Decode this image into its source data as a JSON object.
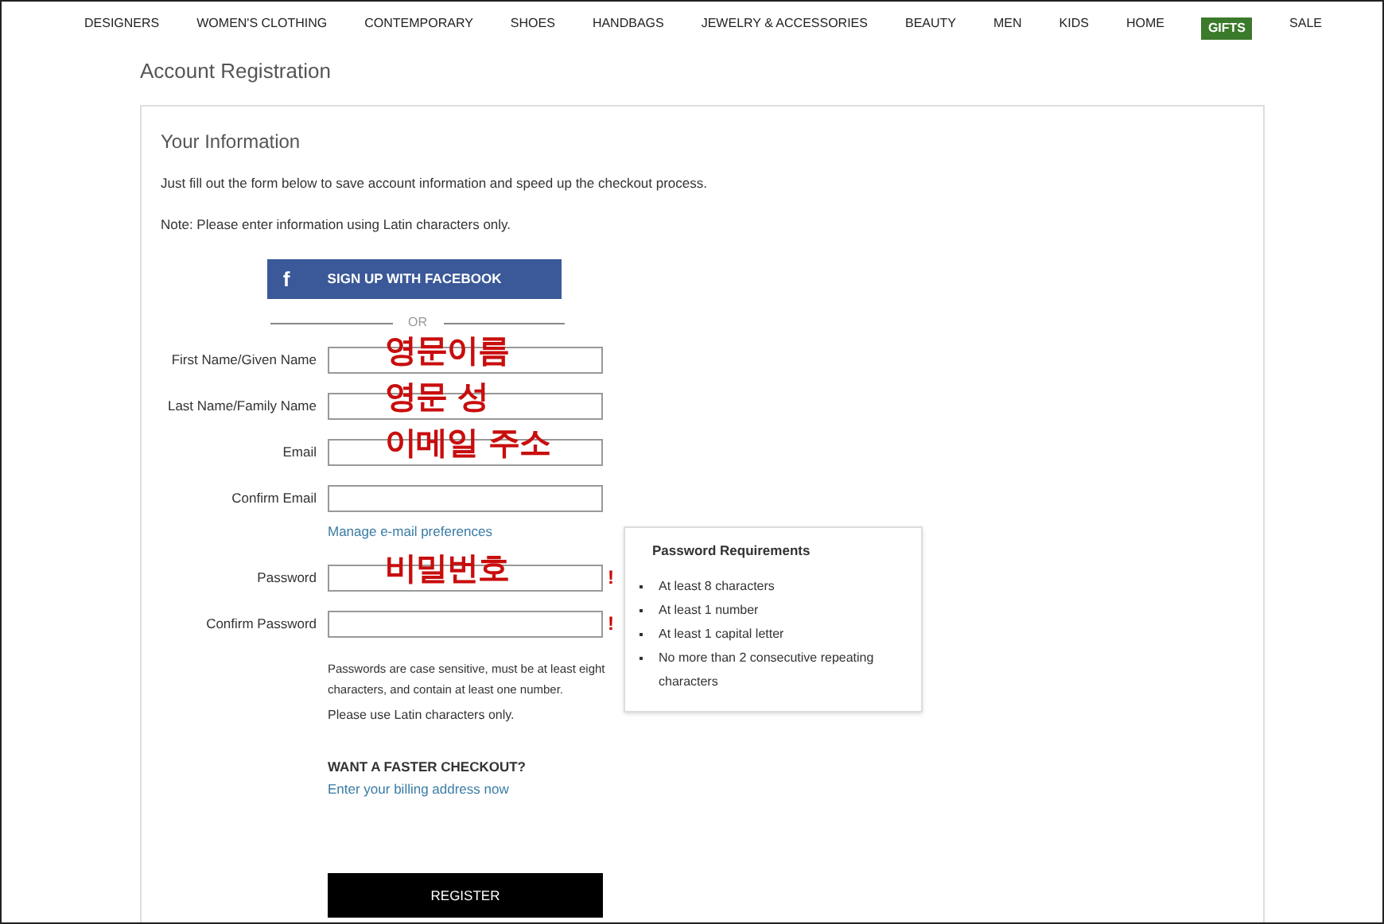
{
  "nav": [
    {
      "label": "DESIGNERS",
      "kind": "text"
    },
    {
      "label": "WOMEN'S CLOTHING",
      "kind": "text"
    },
    {
      "label": "CONTEMPORARY",
      "kind": "text"
    },
    {
      "label": "SHOES",
      "kind": "text"
    },
    {
      "label": "HANDBAGS",
      "kind": "text"
    },
    {
      "label": "JEWELRY & ACCESSORIES",
      "kind": "text"
    },
    {
      "label": "BEAUTY",
      "kind": "text"
    },
    {
      "label": "MEN",
      "kind": "text"
    },
    {
      "label": "KIDS",
      "kind": "text"
    },
    {
      "label": "HOME",
      "kind": "text"
    },
    {
      "label": "GIFTS",
      "kind": "badge"
    },
    {
      "label": "SALE",
      "kind": "text"
    }
  ],
  "page_title": "Account Registration",
  "section_title": "Your Information",
  "intro": "Just fill out the form below to save account information and speed up the checkout process.",
  "note": "Note: Please enter information using Latin characters only.",
  "facebook_button": {
    "icon": "f",
    "label": "SIGN UP WITH FACEBOOK"
  },
  "divider_text": "OR",
  "fields": [
    {
      "label": "First Name/Given Name",
      "annotation": "영문이름",
      "error": false
    },
    {
      "label": "Last Name/Family Name",
      "annotation": "영문 성",
      "error": false
    },
    {
      "label": "Email",
      "annotation": "이메일 주소",
      "error": false
    },
    {
      "label": "Confirm Email",
      "error": false
    }
  ],
  "email_prefs_link": "Manage e-mail preferences",
  "password_fields": [
    {
      "label": "Password",
      "annotation": "비밀번호",
      "error": true
    },
    {
      "label": "Confirm Password",
      "error": true
    }
  ],
  "error_mark": "!",
  "password_help": "Passwords are case sensitive, must be at least eight characters, and contain at least one number.",
  "latin_note": "Please use Latin characters only.",
  "requirements": {
    "title": "Password Requirements",
    "items": [
      "At least 8 characters",
      "At least 1 number",
      "At least 1 capital letter",
      "No more than 2 consecutive repeating characters"
    ]
  },
  "faster_checkout": {
    "title": "WANT A FASTER CHECKOUT?",
    "link": "Enter your billing address now"
  },
  "register_button": "REGISTER"
}
